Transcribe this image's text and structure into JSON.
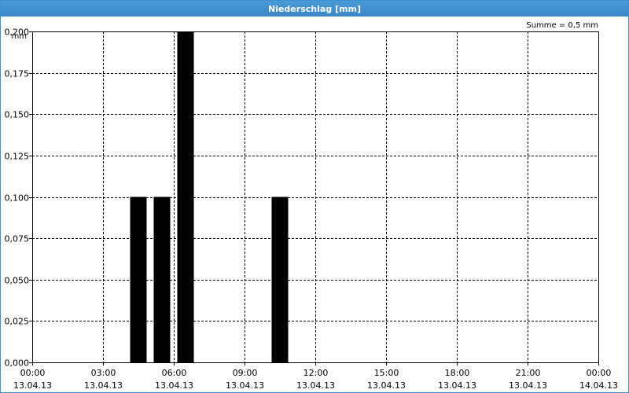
{
  "window": {
    "title": "Niederschlag [mm]"
  },
  "colors": {
    "titlebar": "#3a86c6",
    "bars": "#000000",
    "grid": "#000000"
  },
  "chart_data": {
    "type": "bar",
    "title": "Niederschlag [mm]",
    "ylabel": "mm",
    "annotation": "Summe = 0,5 mm",
    "ylim": [
      0,
      0.2
    ],
    "y_ticks": [
      "0,000",
      "0,025",
      "0,050",
      "0,075",
      "0,100",
      "0,125",
      "0,150",
      "0,175",
      "0,200"
    ],
    "x_ticks": [
      {
        "time": "00:00",
        "date": "13.04.13"
      },
      {
        "time": "03:00",
        "date": "13.04.13"
      },
      {
        "time": "06:00",
        "date": "13.04.13"
      },
      {
        "time": "09:00",
        "date": "13.04.13"
      },
      {
        "time": "12:00",
        "date": "13.04.13"
      },
      {
        "time": "15:00",
        "date": "13.04.13"
      },
      {
        "time": "18:00",
        "date": "13.04.13"
      },
      {
        "time": "21:00",
        "date": "13.04.13"
      },
      {
        "time": "00:00",
        "date": "14.04.13"
      }
    ],
    "xlim_hours": [
      0,
      24
    ],
    "grid": true,
    "series": [
      {
        "bars": [
          {
            "start_hour": 4,
            "end_hour": 5,
            "value": 0.1
          },
          {
            "start_hour": 5,
            "end_hour": 6,
            "value": 0.1
          },
          {
            "start_hour": 6,
            "end_hour": 7,
            "value": 0.2
          },
          {
            "start_hour": 10,
            "end_hour": 11,
            "value": 0.1
          }
        ]
      }
    ]
  }
}
